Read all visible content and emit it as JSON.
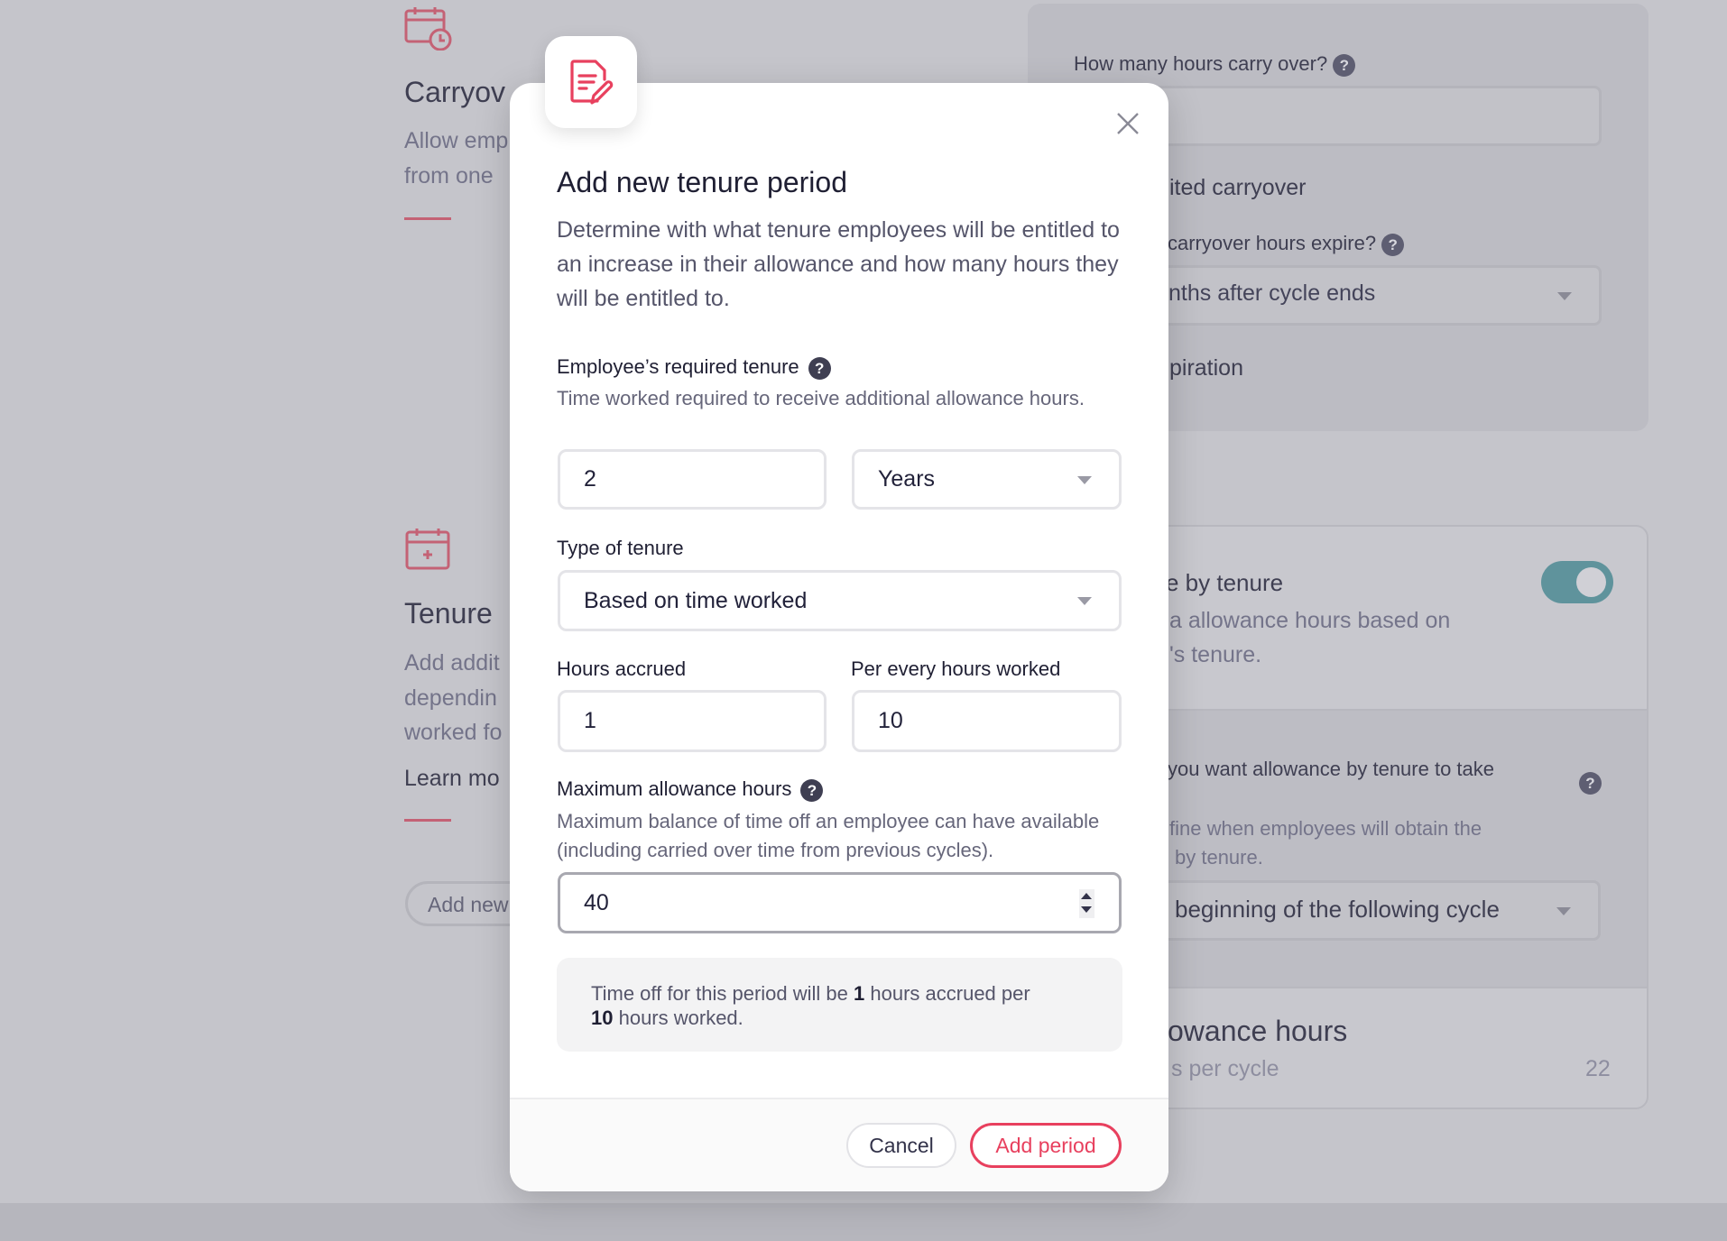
{
  "background": {
    "carryover": {
      "title": "Carryov",
      "desc_lines": [
        "Allow emp",
        "from one"
      ]
    },
    "tenure": {
      "title": "Tenure",
      "desc_lines": [
        "Add addit",
        "dependin",
        "worked fo"
      ],
      "learn_more": "Learn mo",
      "add_button": "Add new"
    },
    "carry_card": {
      "question": "How many hours carry over?",
      "unlimited": "ited carryover",
      "expire_question": "carryover hours expire?",
      "expire_value": "nths after cycle ends",
      "no_expiration": "piration"
    },
    "tenure_card": {
      "title": "e by tenure",
      "desc_lines": [
        "a allowance hours based on",
        "'s tenure."
      ],
      "toggle_on": true,
      "when_question": "you want allowance by tenure to take",
      "when_desc_lines": [
        "fine when employees will obtain the",
        "by tenure."
      ],
      "when_value": "beginning of the following cycle",
      "max_title": "owance hours",
      "max_sub": "s per cycle",
      "max_value": "22"
    },
    "accent": "#c46275",
    "toggle_color": "#5f939c"
  },
  "modal": {
    "icon": "document-edit-icon",
    "title": "Add new tenure period",
    "description": "Determine with what tenure employees will be entitled to an increase in their allowance and how many hours they will be entitled to.",
    "required_tenure": {
      "label": "Employee’s required tenure",
      "help": "Time worked required to receive additional allowance hours.",
      "value": "2",
      "unit": "Years"
    },
    "type_of_tenure": {
      "label": "Type of tenure",
      "value": "Based on time worked"
    },
    "hours_accrued": {
      "label": "Hours accrued",
      "value": "1"
    },
    "per_every": {
      "label": "Per every hours worked",
      "value": "10"
    },
    "max_allowance": {
      "label": "Maximum allowance hours",
      "help": "Maximum balance of time off an employee can have available (including carried over time from previous cycles).",
      "value": "40"
    },
    "summary": {
      "pre": "Time off for this period will be ",
      "hours": "1",
      "mid": " hours accrued per ",
      "per": "10",
      "post": " hours worked."
    },
    "cancel": "Cancel",
    "submit": "Add period",
    "accent": "#e8405e"
  }
}
